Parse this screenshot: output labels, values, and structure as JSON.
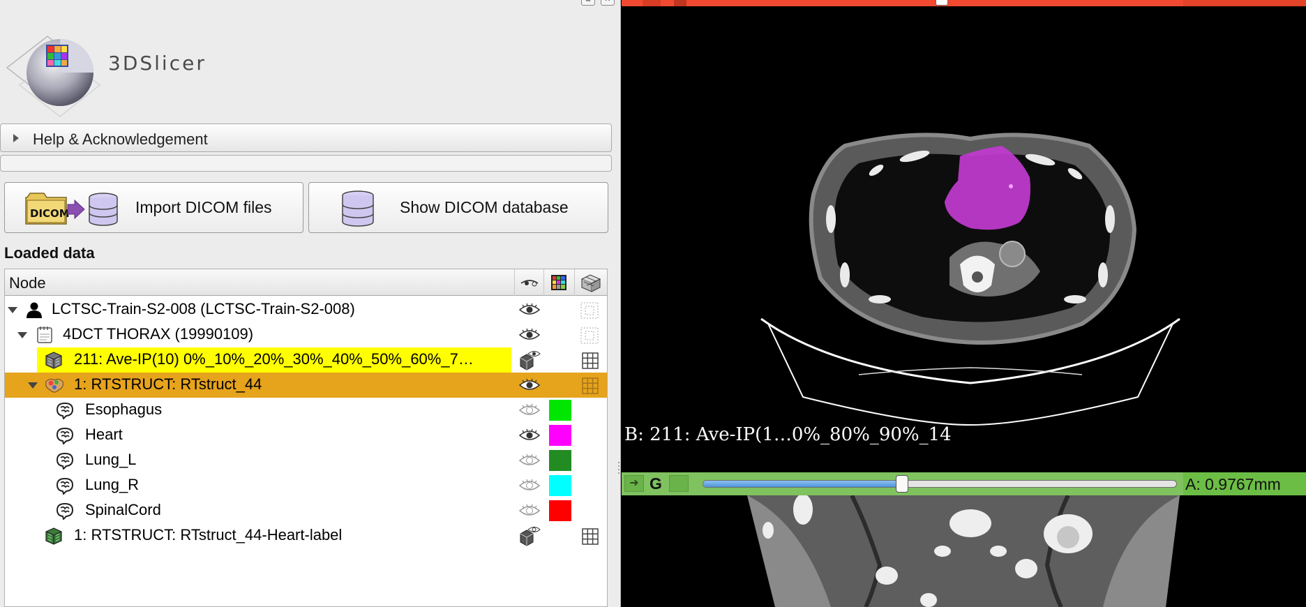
{
  "app": {
    "logo_text": "3DSlicer"
  },
  "help": {
    "label": "Help & Acknowledgement"
  },
  "dicom": {
    "import_label": "Import DICOM files",
    "show_db_label": "Show DICOM database",
    "folder_text": "DICOM"
  },
  "loaded_data": {
    "title": "Loaded data",
    "column_node": "Node"
  },
  "tree_rows": [
    {
      "label": "LCTSC-Train-S2-008 (LCTSC-Train-S2-008)",
      "icon": "patient-icon",
      "expanded": true
    },
    {
      "label": "4DCT THORAX (19990109)",
      "icon": "study-icon",
      "expanded": true
    },
    {
      "label": "211: Ave-IP(10) 0%_10%_20%_30%_40%_50%_60%_7…",
      "icon": "volume-icon",
      "highlight": "#ffff00"
    },
    {
      "label": "1: RTSTRUCT: RTstruct_44",
      "icon": "segmentation-icon",
      "highlight": "#e6a31c",
      "expanded": true
    },
    {
      "label": "Esophagus",
      "icon": "segment-icon",
      "color": "#00e600"
    },
    {
      "label": "Heart",
      "icon": "segment-icon",
      "color": "#ff00ff"
    },
    {
      "label": "Lung_L",
      "icon": "segment-icon",
      "color": "#228b22"
    },
    {
      "label": "Lung_R",
      "icon": "segment-icon",
      "color": "#00ffff"
    },
    {
      "label": "SpinalCord",
      "icon": "segment-icon",
      "color": "#ff0000"
    },
    {
      "label": "1: RTSTRUCT: RTstruct_44-Heart-label",
      "icon": "labelmap-icon"
    }
  ],
  "viewers": {
    "axial_label": "B: 211: Ave-IP(1…0%_80%_90%_14",
    "green_letter": "G",
    "green_offset": "A: 0.9767mm",
    "green_slider_fraction": 0.42,
    "colors": {
      "red_bar": "#f24a31",
      "green_bar": "#7fc25f",
      "heart_overlay": "#c13bd0"
    }
  }
}
